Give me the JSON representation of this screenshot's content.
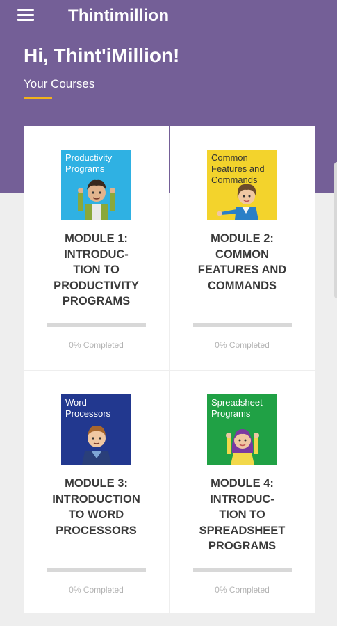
{
  "app": {
    "title": "Thintimillion"
  },
  "header": {
    "greeting": "Hi, Thint'iMillion!",
    "section_label": "Your Courses"
  },
  "courses": [
    {
      "thumb_caption": "Productivity\nPrograms",
      "title": "MODULE 1:\nINTRODUC-\nTION TO\nPRODUCTIVITY\nPROGRAMS",
      "progress": 0,
      "progress_text": "0% Completed",
      "thumb_color": "#2fb1e3"
    },
    {
      "thumb_caption": "Common\nFeatures and\nCommands",
      "title": "MODULE 2:\nCOMMON\nFEATURES AND\nCOMMANDS",
      "progress": 0,
      "progress_text": "0% Completed",
      "thumb_color": "#f3d32c"
    },
    {
      "thumb_caption": "Word\nProcessors",
      "title": "MODULE 3:\nINTRODUCTION\nTO WORD\nPROCESSORS",
      "progress": 0,
      "progress_text": "0% Completed",
      "thumb_color": "#22388f"
    },
    {
      "thumb_caption": "Spreadsheet\nPrograms",
      "title": "MODULE 4:\nINTRODUC-\nTION TO\nSPREADSHEET\nPROGRAMS",
      "progress": 0,
      "progress_text": "0% Completed",
      "thumb_color": "#20a145"
    }
  ],
  "colors": {
    "primary": "#745f97",
    "accent": "#f2b21b",
    "background": "#eeeeee"
  }
}
